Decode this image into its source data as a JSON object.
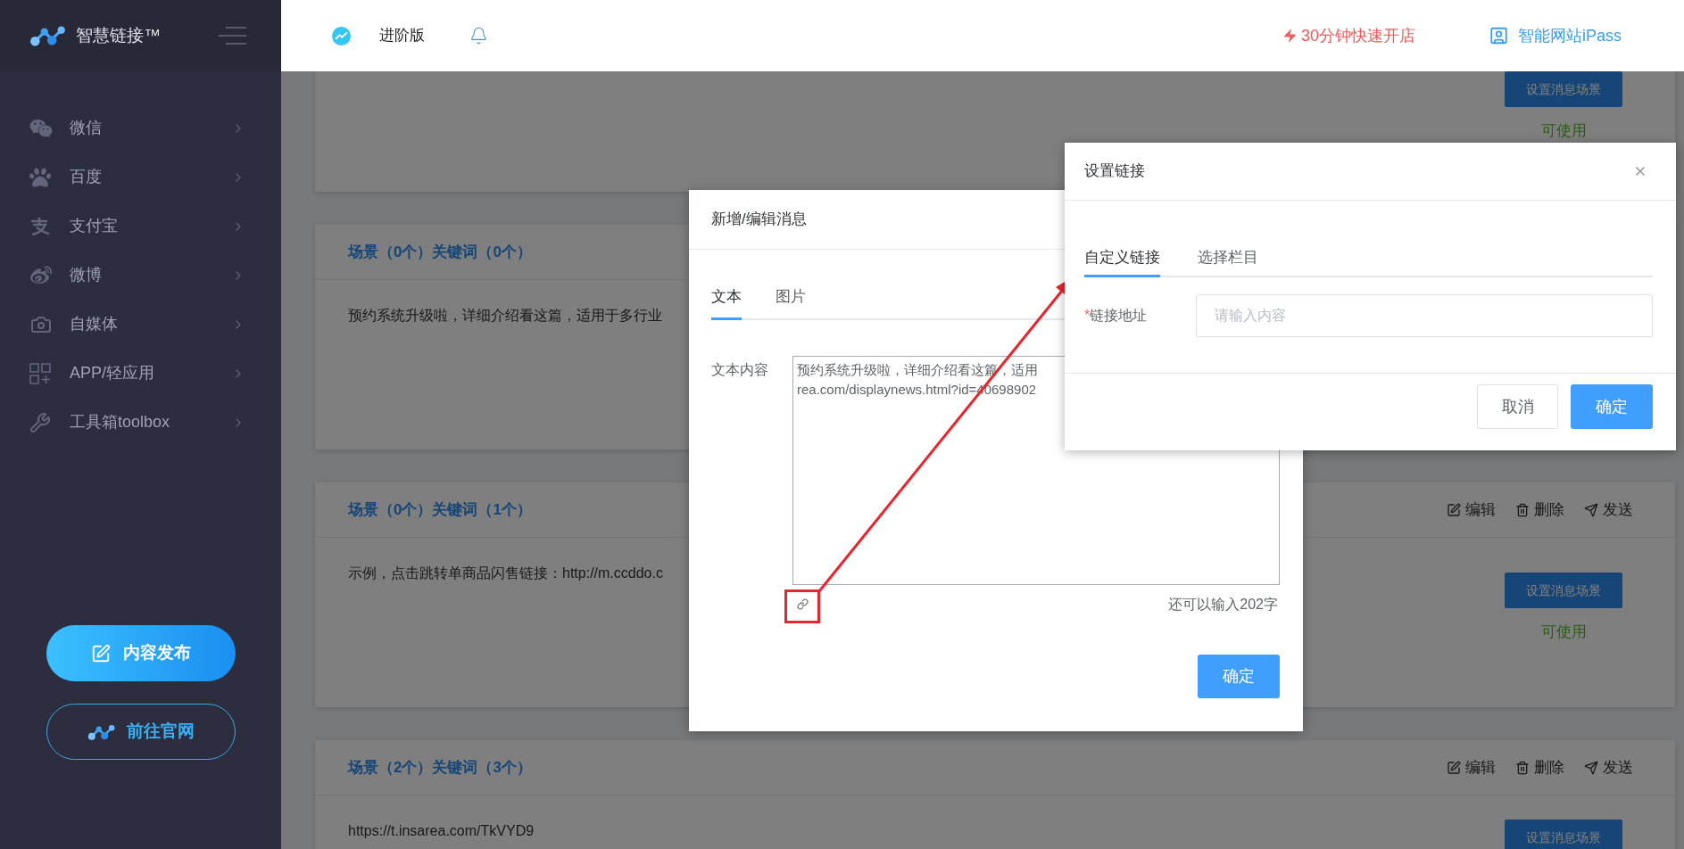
{
  "sidebar": {
    "brand": "智慧链接™",
    "items": [
      {
        "label": "微信"
      },
      {
        "label": "百度"
      },
      {
        "label": "支付宝"
      },
      {
        "label": "微博"
      },
      {
        "label": "自媒体"
      },
      {
        "label": "APP/轻应用"
      },
      {
        "label": "工具箱toolbox"
      }
    ],
    "buttons": [
      {
        "label": "内容发布",
        "kind": "primary"
      },
      {
        "label": "前往官网",
        "kind": "outline"
      }
    ]
  },
  "topbar": {
    "edition": "进阶版",
    "promo": "30分钟快速开店",
    "site": "智能网站iPass"
  },
  "cards": [
    {
      "status_button": "设置消息场景",
      "status": "可使用"
    },
    {
      "title": "场景（0个）关键词（0个）",
      "body": "预约系统升级啦，详细介绍看这篇，适用于多行业"
    },
    {
      "title": "场景（0个）关键词（1个）",
      "actions": [
        "编辑",
        "删除",
        "发送"
      ],
      "body": "示例，点击跳转单商品闪售链接：http://m.ccddo.c",
      "status_button": "设置消息场景",
      "status": "可使用"
    },
    {
      "title": "场景（2个）关键词（3个）",
      "actions": [
        "编辑",
        "删除",
        "发送"
      ],
      "body": "https://t.insarea.com/TkVYD9",
      "status_button": "设置消息场景"
    }
  ],
  "message_dialog": {
    "title": "新增/编辑消息",
    "tabs": [
      {
        "label": "文本",
        "selected": true
      },
      {
        "label": "图片",
        "selected": false
      }
    ],
    "field_label": "文本内容",
    "content_lines": [
      "预约系统升级啦，详细介绍看这篇，适用",
      "rea.com/displaynews.html?id=40698902"
    ],
    "counter": "还可以输入202字",
    "confirm": "确定"
  },
  "link_dialog": {
    "title": "设置链接",
    "tabs": [
      {
        "label": "自定义链接",
        "selected": true
      },
      {
        "label": "选择栏目",
        "selected": false
      }
    ],
    "field": {
      "required_mark": "*",
      "label": "链接地址",
      "placeholder": "请输入内容"
    },
    "buttons": [
      {
        "label": "取消",
        "kind": "default"
      },
      {
        "label": "确定",
        "kind": "primary"
      }
    ]
  }
}
